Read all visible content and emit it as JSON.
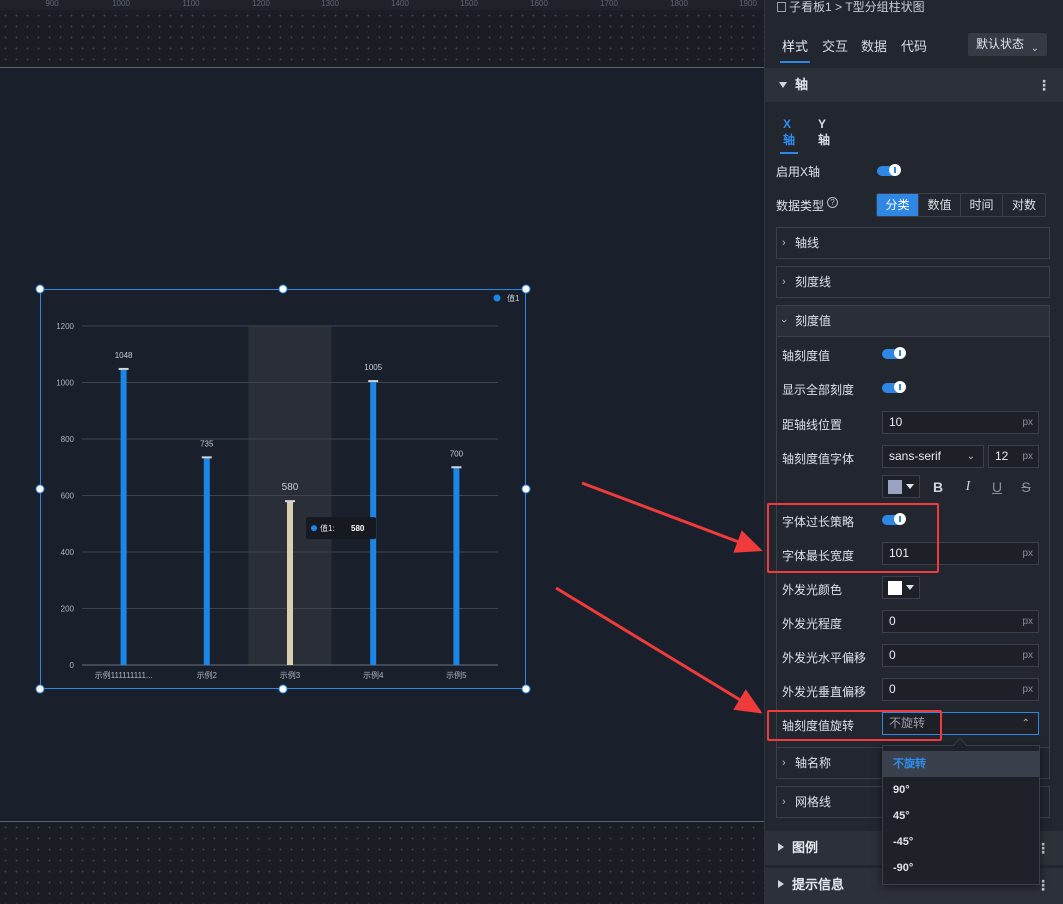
{
  "ruler": {
    "ticks": [
      "900",
      "1000",
      "1100",
      "1200",
      "1300",
      "1400",
      "1500",
      "1600",
      "1700",
      "1800",
      "1900"
    ]
  },
  "chart_data": {
    "type": "bar",
    "categories": [
      "示例111111111...",
      "示例2",
      "示例3",
      "示例4",
      "示例5"
    ],
    "series": [
      {
        "name": "值1",
        "values": [
          1048,
          735,
          580,
          1005,
          700
        ]
      }
    ],
    "ylim": [
      0,
      1200
    ],
    "yticks": [
      "0",
      "200",
      "400",
      "600",
      "800",
      "1000",
      "1200"
    ],
    "legend": "top-right",
    "grid": true,
    "highlighted_index": 2,
    "tooltip": {
      "name": "值1",
      "sep": ":",
      "value": "580"
    },
    "colors": {
      "bar": "#1a86e8",
      "highlight": "#d8cfae",
      "cap": "#cfd3da"
    }
  },
  "breadcrumb": "子看板1 > T型分组柱状图",
  "tabs": [
    "样式",
    "交互",
    "数据",
    "代码"
  ],
  "state_select": "默认状态",
  "section_axis": "轴",
  "axis_tabs": [
    "X轴",
    "Y轴"
  ],
  "enable_x_axis": "启用X轴",
  "data_type_label": "数据类型",
  "data_type_options": [
    "分类",
    "数值",
    "时间",
    "对数"
  ],
  "cards": {
    "axis_line": "轴线",
    "tick_line": "刻度线",
    "tick_value": "刻度值",
    "axis_name": "轴名称",
    "grid_line": "网格线"
  },
  "tick_value": {
    "axis_tick_value": "轴刻度值",
    "show_all_ticks": "显示全部刻度",
    "distance_label": "距轴线位置",
    "distance_value": "10",
    "font_label": "轴刻度值字体",
    "font_family": "sans-serif",
    "font_size": "12",
    "unit": "px",
    "font_color": "#9aa4c0",
    "overflow_label": "字体过长策略",
    "max_width_label": "字体最长宽度",
    "max_width_value": "101",
    "glow_color_label": "外发光颜色",
    "glow_color": "#ffffff",
    "glow_level_label": "外发光程度",
    "glow_level_value": "0",
    "glow_x_label": "外发光水平偏移",
    "glow_x_value": "0",
    "glow_y_label": "外发光垂直偏移",
    "glow_y_value": "0",
    "rotate_label": "轴刻度值旋转",
    "rotate_value": "不旋转"
  },
  "rotate_options": [
    "不旋转",
    "90°",
    "45°",
    "-45°",
    "-90°"
  ],
  "section_legend": "图例",
  "section_tooltip": "提示信息",
  "accent_color": "#2f87e5",
  "annotation_color": "#ef3b3b"
}
